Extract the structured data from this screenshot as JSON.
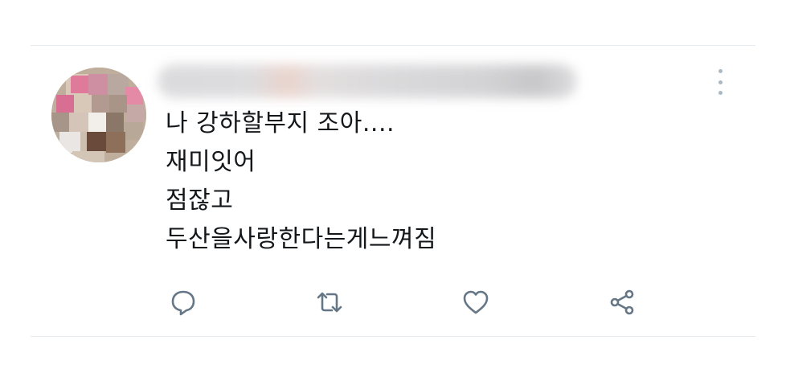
{
  "tweet": {
    "text_lines": [
      "나 강하할부지 조아....",
      "재미잇어",
      "점잖고",
      "두산을사랑한다는게느껴짐"
    ]
  },
  "actions": {
    "reply_icon": "reply-icon",
    "retweet_icon": "retweet-icon",
    "like_icon": "heart-icon",
    "share_icon": "share-icon"
  },
  "menu": {
    "icon": "more-vertical-icon"
  },
  "colors": {
    "text": "#14171a",
    "icon": "#657786",
    "divider": "#e6ecf0",
    "menu_dots": "#aab8c2"
  }
}
